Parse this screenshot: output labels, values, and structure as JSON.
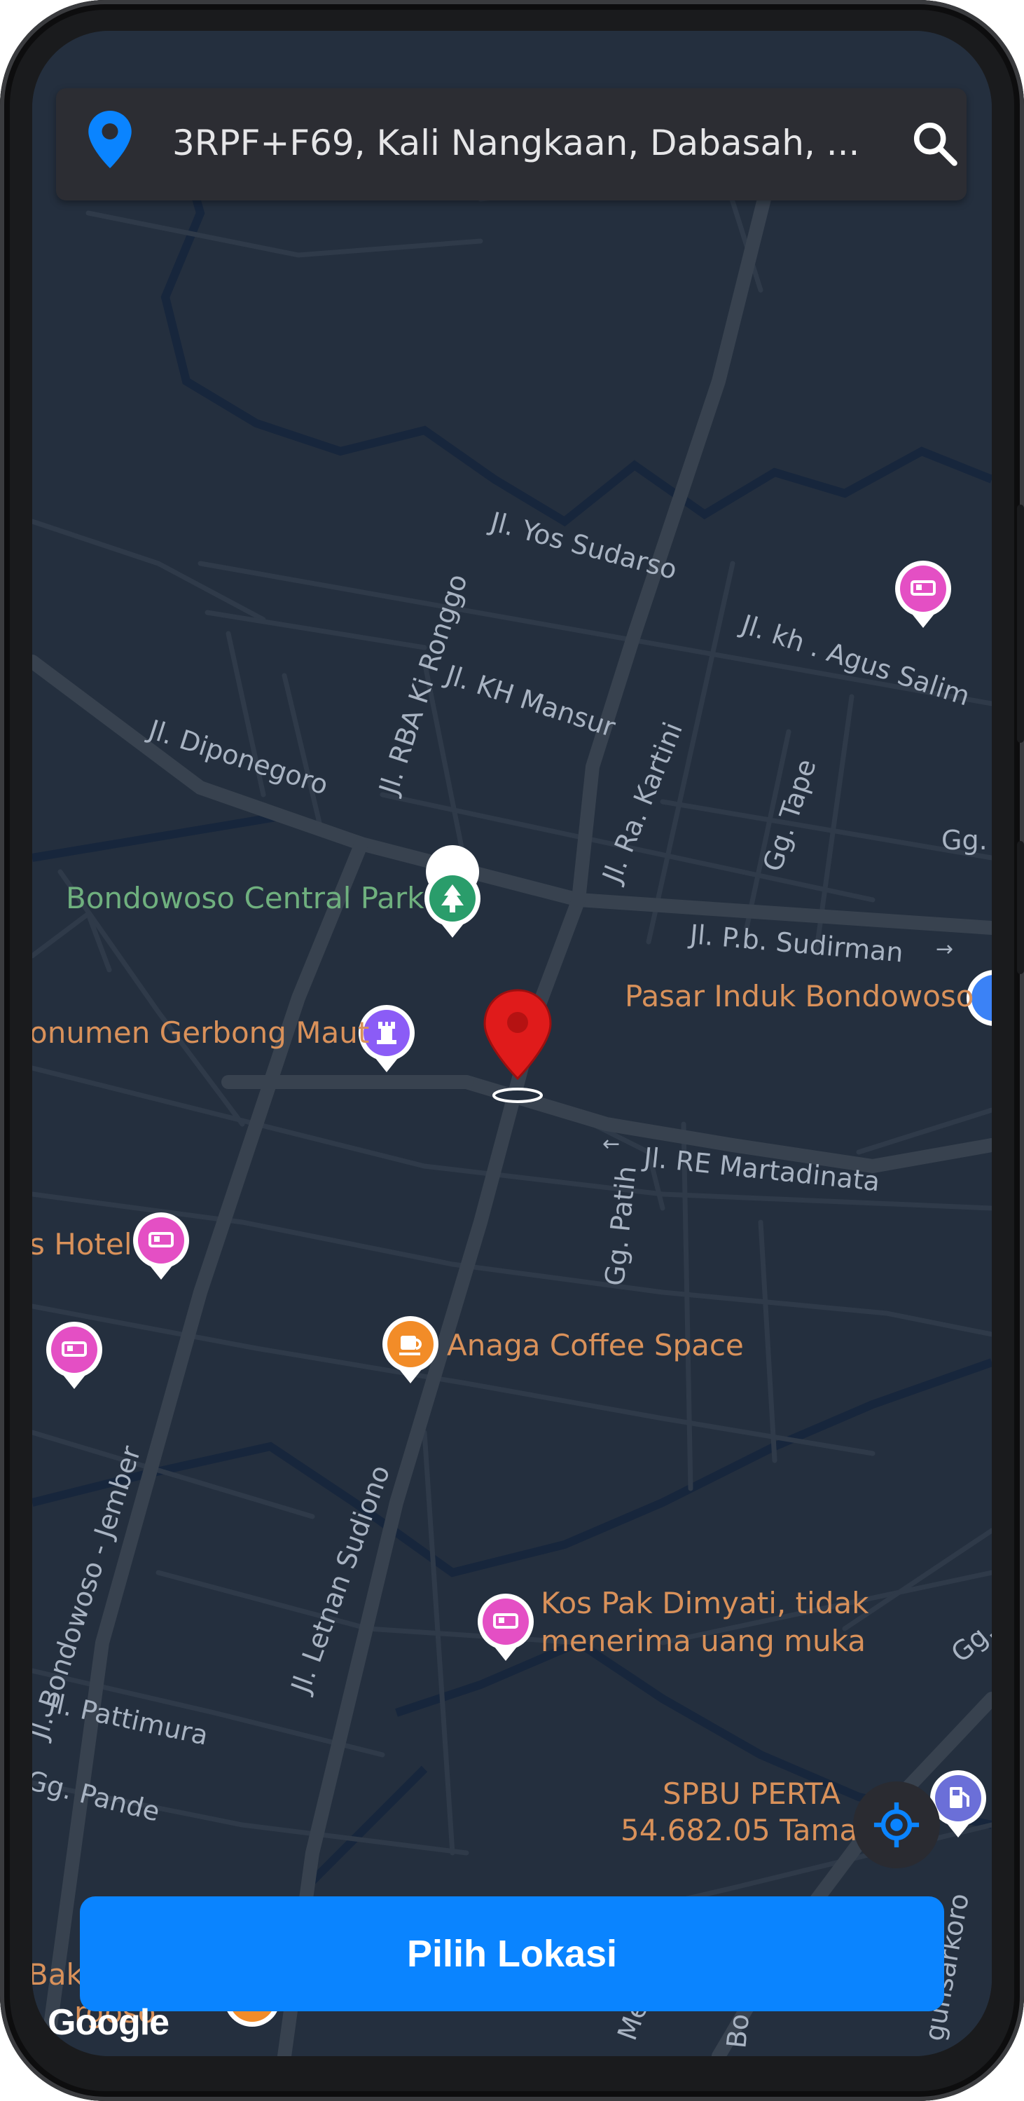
{
  "search": {
    "address": "3RPF+F69, Kali Nangkaan, Dabasah, ...",
    "pin_icon": "location-pin-icon",
    "search_icon": "search-icon"
  },
  "streets": [
    {
      "name": "Jl. Yos Sudarso"
    },
    {
      "name": "Jl. kh . Agus Salim"
    },
    {
      "name": "Jl. RBA Ki Ronggo"
    },
    {
      "name": "Jl. KH Mansur"
    },
    {
      "name": "Jl. Diponegoro"
    },
    {
      "name": "Jl. Ra. Kartini"
    },
    {
      "name": "Gg. Tape"
    },
    {
      "name": "Gg."
    },
    {
      "name": "Jl. P.b. Sudirman"
    },
    {
      "name": "Jl. RE Martadinata"
    },
    {
      "name": "Gg. Patih"
    },
    {
      "name": "Jl. Bondowoso - Jember"
    },
    {
      "name": "Jl. Letnan Sudiono"
    },
    {
      "name": "Jl. Pattimura"
    },
    {
      "name": "Gg. Pande"
    },
    {
      "name": "Gg."
    },
    {
      "name": "Merpa"
    },
    {
      "name": "Bo"
    },
    {
      "name": "gunsarkoro"
    }
  ],
  "pois": [
    {
      "label": "Bondowoso Central Park",
      "icon": "tree-icon",
      "color": "#2a9d6b"
    },
    {
      "label": "onumen Gerbong Maut",
      "icon": "monument-icon",
      "color": "#8b5cf6"
    },
    {
      "label": "Pasar Induk Bondowoso",
      "icon": "shopping-icon",
      "color": "#3b82f6"
    },
    {
      "label": "s Hotel",
      "icon": "bed-icon",
      "color": "#e44fc4"
    },
    {
      "label": "",
      "icon": "bed-icon",
      "color": "#e44fc4"
    },
    {
      "label": "",
      "icon": "bed-icon",
      "color": "#e44fc4"
    },
    {
      "label": "Anaga Coffee Space",
      "icon": "coffee-icon",
      "color": "#f28c28"
    },
    {
      "label": "Kos Pak Dimyati, tidak",
      "label2": "menerima uang muka",
      "icon": "bed-icon",
      "color": "#e44fc4"
    },
    {
      "label": "SPBU PERTA",
      "label2": "54.682.05 Tama",
      "icon": "fuel-icon",
      "color": "#6b6fd8"
    },
    {
      "label": "Bak",
      "label2": "rgoso",
      "icon": "restaurant-icon",
      "color": "#f28c28"
    }
  ],
  "colors": {
    "map_bg": "#242f3e",
    "road_major": "#3a4350",
    "road_minor": "#2e3846",
    "label_green": "#6fb07e",
    "label_orange": "#d9915a",
    "street_text": "#a8b3c2",
    "accent": "#0a84ff"
  },
  "cta": {
    "label": "Pilih Lokasi"
  },
  "attribution": {
    "label": "Google"
  },
  "locate_icon": "my-location-icon"
}
